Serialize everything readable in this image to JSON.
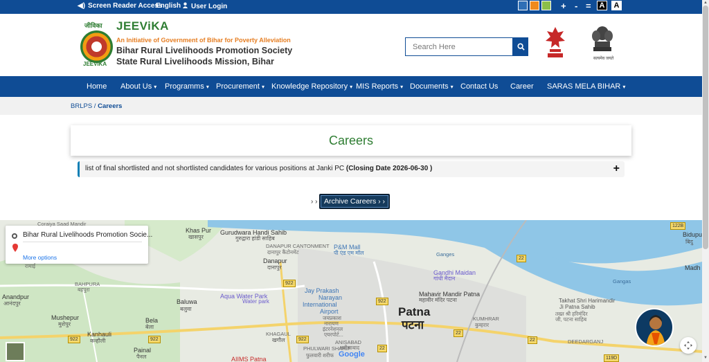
{
  "topbar": {
    "screen_reader": "Screen Reader Access",
    "language": "English",
    "user_login": "User Login",
    "theme_colors": [
      "#2f6fb6",
      "#f08a1c",
      "#8bbf4a"
    ],
    "font_increase": "+",
    "font_decrease": "-",
    "font_reset": "=",
    "contrast_dark": "A",
    "contrast_light": "A"
  },
  "header": {
    "logo_top": "जीविका",
    "logo_bottom": "JEEViKA",
    "brand": "JEEViKA",
    "tagline": "An Initiative of Government of Bihar for Poverty Alleviation",
    "org_line1": "Bihar Rural Livelihoods Promotion Society",
    "org_line2": "State Rural Livelihoods Mission, Bihar",
    "search_placeholder": "Search Here",
    "emblem_caption": "सत्यमेव जयते"
  },
  "nav": {
    "items": [
      {
        "label": "Home",
        "dropdown": ""
      },
      {
        "label": "About Us",
        "dropdown": "▾"
      },
      {
        "label": "Programms",
        "dropdown": "▾"
      },
      {
        "label": "Procurement",
        "dropdown": "▾"
      },
      {
        "label": "Knowledge Repository",
        "dropdown": "▾"
      },
      {
        "label": "MIS Reports",
        "dropdown": "▾"
      },
      {
        "label": "Documents",
        "dropdown": "▾"
      },
      {
        "label": "Contact Us",
        "dropdown": ""
      },
      {
        "label": "Career",
        "dropdown": ""
      },
      {
        "label": "SARAS MELA BIHAR",
        "dropdown": "▾"
      }
    ]
  },
  "breadcrumb": {
    "root": "BRLPS",
    "separator": " / ",
    "current": "Careers"
  },
  "careers": {
    "title": "Careers",
    "job_text": "list of final shortlisted and not shortlisted candidates for various positions at Janki PC ",
    "closing_label": "(Closing Date 2026-06-30 )",
    "expand": "+",
    "arrows": "› ›",
    "archive_button": "Archive Careers › ›"
  },
  "map": {
    "place_name": "Bihar Rural Livelihoods Promotion Socie...",
    "more_options": "More options",
    "google": "Google",
    "labels": [
      {
        "text": "Khas Pur"
      },
      {
        "text": "खासपुर"
      },
      {
        "text": "Gurudwara Handi Sahib"
      },
      {
        "text": "गुरुद्वारा हांडी साहिब"
      },
      {
        "text": "DANAPUR CANTONMENT"
      },
      {
        "text": "दानापुर कैंटोनमेंट"
      },
      {
        "text": "Danapur"
      },
      {
        "text": "दानापुर"
      },
      {
        "text": "P&M Mall"
      },
      {
        "text": "पी एंड एम मॉल"
      },
      {
        "text": "Gandhi Maidan"
      },
      {
        "text": "गांधी मैदान"
      },
      {
        "text": "Mahavir Mandir Patna"
      },
      {
        "text": "महावीर मंदिर पटना"
      },
      {
        "text": "Patna"
      },
      {
        "text": "पटना"
      },
      {
        "text": "Jay Prakash"
      },
      {
        "text": "Narayan"
      },
      {
        "text": "International"
      },
      {
        "text": "Airport"
      },
      {
        "text": "जयप्रकाश"
      },
      {
        "text": "नारायण"
      },
      {
        "text": "इंटरनेशनल"
      },
      {
        "text": "एयरपोर्ट..."
      },
      {
        "text": "Aqua Water Park"
      },
      {
        "text": "Water park"
      },
      {
        "text": "Baluwa"
      },
      {
        "text": "बलुवा"
      },
      {
        "text": "Bela"
      },
      {
        "text": "बेला"
      },
      {
        "text": "Anandpur"
      },
      {
        "text": "आनंदपुर"
      },
      {
        "text": "Mushepur"
      },
      {
        "text": "मुशेपुर"
      },
      {
        "text": "Kanhauli"
      },
      {
        "text": "कन्हौली"
      },
      {
        "text": "Painal"
      },
      {
        "text": "पैनल"
      },
      {
        "text": "KHAGAUL"
      },
      {
        "text": "खगौल"
      },
      {
        "text": "ANISABAD"
      },
      {
        "text": "अनीसाबाद"
      },
      {
        "text": "PHULWARI SHARIF"
      },
      {
        "text": "फुलवारी शरीफ"
      },
      {
        "text": "KUMHRAR"
      },
      {
        "text": "कुम्हरार"
      },
      {
        "text": "Takhat Shri Harimandir"
      },
      {
        "text": "Ji Patna Sahib"
      },
      {
        "text": "तख्त श्री हरिमंदिर"
      },
      {
        "text": "जी, पटना साहिब"
      },
      {
        "text": "DEEDARGANJ"
      },
      {
        "text": "Bidupur"
      },
      {
        "text": "बिदु"
      },
      {
        "text": "Madh"
      },
      {
        "text": "AIIMS Patna"
      },
      {
        "text": "BAHPURA"
      },
      {
        "text": "बहपुरा"
      },
      {
        "text": "Ganges"
      },
      {
        "text": "Gangas"
      },
      {
        "text": "Coraiya Saad Mandir"
      },
      {
        "text": "रामाई"
      }
    ],
    "road_tags": [
      "922",
      "922",
      "922",
      "922",
      "922",
      "22",
      "22",
      "22",
      "22",
      "122B",
      "119D"
    ]
  },
  "scroll": {
    "up": "▲",
    "down": "▼"
  }
}
